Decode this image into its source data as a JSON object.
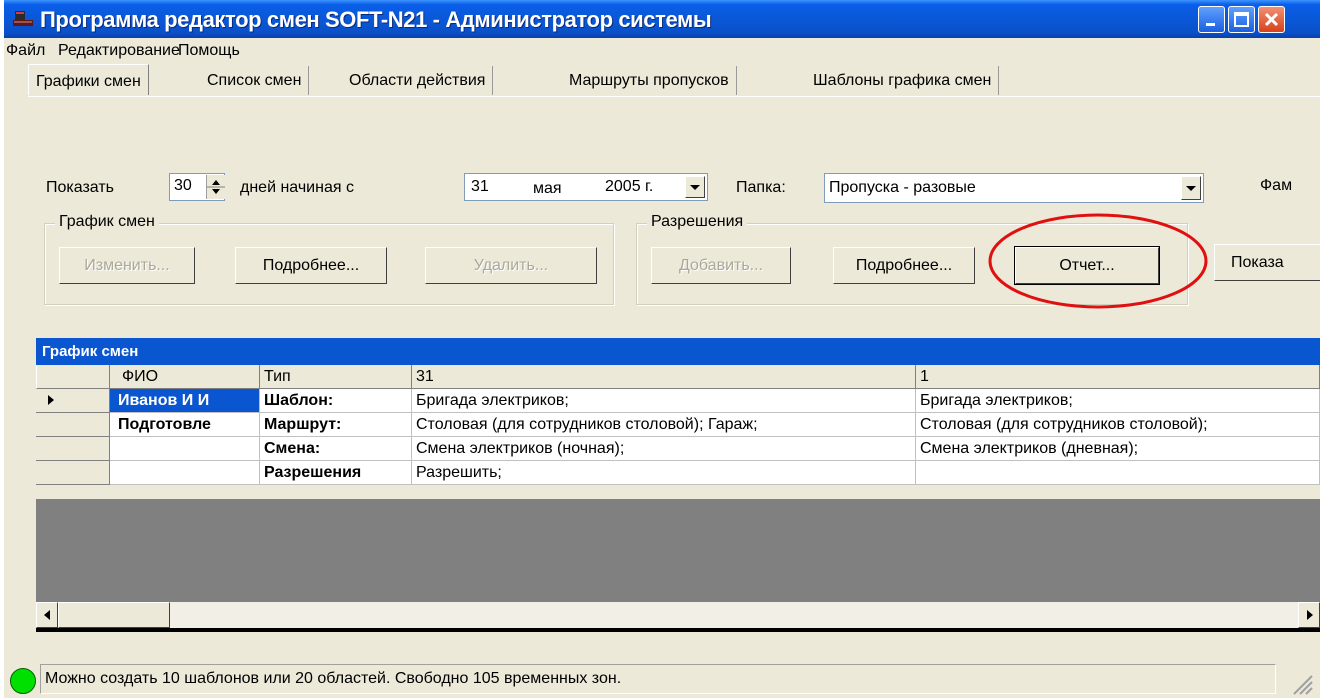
{
  "window": {
    "title": "Программа редактор смен SOFT-N21 - Администратор системы"
  },
  "menu": [
    "Файл",
    "Редактирование",
    "Помощь"
  ],
  "tabs": [
    "Графики смен",
    "Список смен",
    "Области действия",
    "Маршруты пропусков",
    "Шаблоны графика смен"
  ],
  "filter": {
    "show_label": "Показать",
    "days_value": "30",
    "days_label": "дней начиная с",
    "date_day": "31",
    "date_month": "мая",
    "date_year": "2005 г.",
    "folder_label": "Папка:",
    "folder_value": "Пропуска - разовые",
    "fam_label": "Фам"
  },
  "schedule_group": {
    "title": "График смен",
    "change_button": "Изменить...",
    "details_button": "Подробнее...",
    "delete_button": "Удалить..."
  },
  "permissions_group": {
    "title": "Разрешения",
    "add_button": "Добавить...",
    "details_button": "Подробнее...",
    "report_button": "Отчет..."
  },
  "show_button": "Показа",
  "grid": {
    "title": "График смен",
    "columns": [
      "ФИО",
      "Тип",
      "31",
      "1"
    ],
    "rows": [
      {
        "fio": "Иванов И И",
        "type": "Шаблон:",
        "d31": "Бригада электриков;",
        "d1": "Бригада электриков;"
      },
      {
        "fio": "Подготовле",
        "type": "Маршрут:",
        "d31": "Столовая (для сотрудников столовой); Гараж;",
        "d1": "Столовая (для сотрудников столовой);"
      },
      {
        "fio": "",
        "type": "Смена:",
        "d31": "Смена электриков (ночная);",
        "d1": "Смена электриков (дневная);"
      },
      {
        "fio": "",
        "type": "Разрешения",
        "d31": "Разрешить;",
        "d1": ""
      }
    ]
  },
  "status": {
    "text": "Можно создать 10 шаблонов или 20 областей. Свободно 105 временных зон.",
    "indicator_color": "#00e000"
  },
  "colors": {
    "titlebar": "#0a57d6",
    "grid_header": "#0a56d0",
    "highlight_circle": "#e01010"
  }
}
